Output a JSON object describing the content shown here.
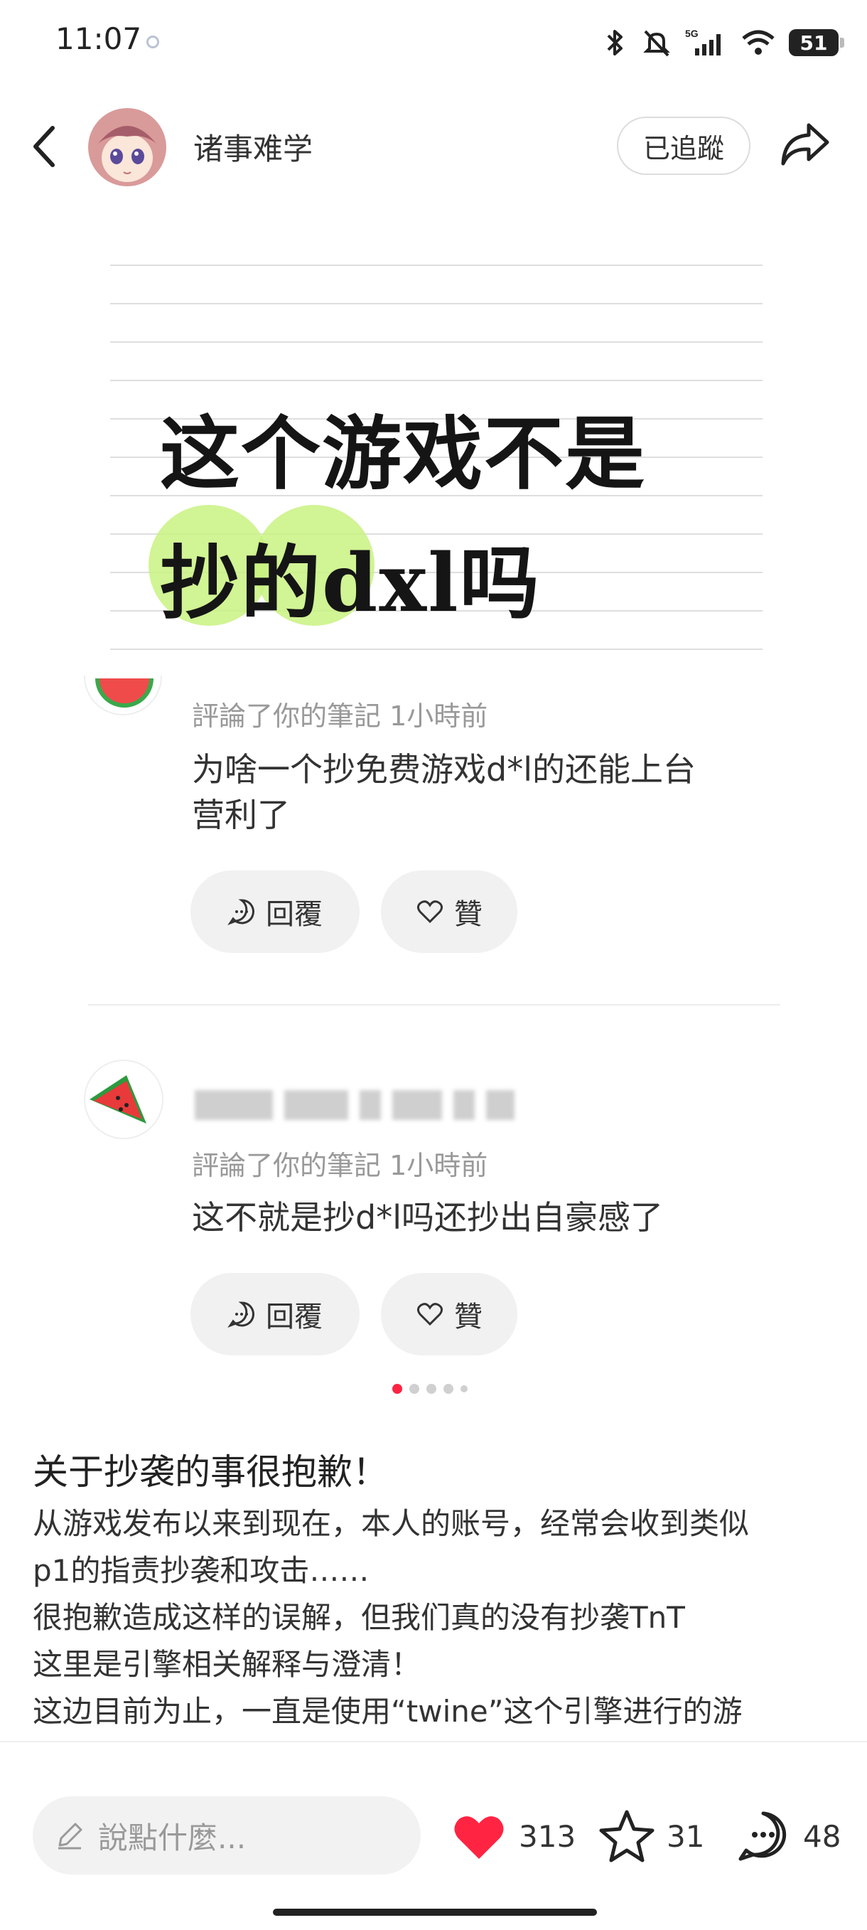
{
  "status": {
    "time": "11:07",
    "battery": "51"
  },
  "header": {
    "author": "诸事难学",
    "follow_label": "已追蹤"
  },
  "image": {
    "headline_line1": "这个游戏不是",
    "headline_line2_a": "抄",
    "headline_line2_b": "的",
    "headline_line2_c": "dxl吗"
  },
  "comments": [
    {
      "meta": "評論了你的筆記  1小時前",
      "text_line1": "为啥一个抄免费游戏d*l的还能上台",
      "text_line2": "营利了",
      "reply_label": "回覆",
      "like_label": "贊"
    },
    {
      "meta": "評論了你的筆記  1小時前",
      "text_line1": "这不就是抄d*l吗还抄出自豪感了",
      "reply_label": "回覆",
      "like_label": "贊"
    }
  ],
  "post": {
    "title": "关于抄袭的事很抱歉！",
    "body": "从游戏发布以来到现在，本人的账号，经常会收到类似\np1的指责抄袭和攻击……\n很抱歉造成这样的误解，但我们真的没有抄袭TnT\n这里是引擎相关解释与澄清！\n这边目前为止，一直是使用“twine”这个引擎进行的游\n戏制作。目前没有设计并制作UI，一直使用的是引擎默"
  },
  "bottom": {
    "input_placeholder": "說點什麼...",
    "likes": "313",
    "stars": "31",
    "comments": "48",
    "like_color": "#ff2442"
  },
  "carousel": {
    "pages": 5,
    "active": 1
  }
}
